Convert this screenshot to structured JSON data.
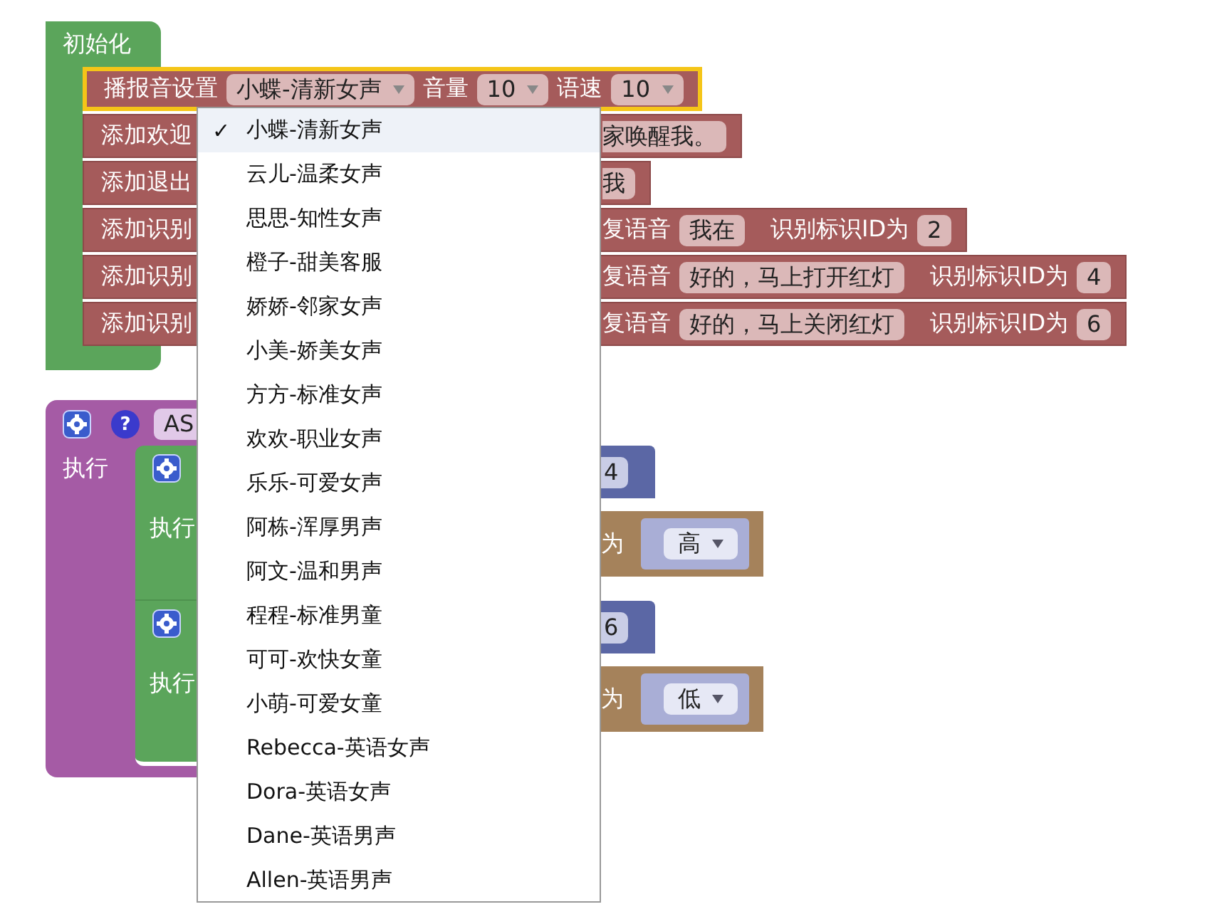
{
  "init_block": {
    "label": "初始化",
    "statements": [
      {
        "kind": "voice",
        "selected": true,
        "label": "播报音设置",
        "voice": "小蝶-清新女声",
        "volume_label": "音量",
        "volume": "10",
        "speed_label": "语速",
        "speed": "10"
      },
      {
        "kind": "text",
        "selected": false,
        "label": "添加欢迎",
        "value": "家唤醒我。"
      },
      {
        "kind": "text",
        "selected": false,
        "label": "添加退出",
        "value": "我"
      },
      {
        "kind": "recognize",
        "selected": false,
        "label": "添加识别",
        "reply_label": "复语音",
        "reply": "我在",
        "id_label": "识别标识ID为",
        "id": "2"
      },
      {
        "kind": "recognize",
        "selected": false,
        "label": "添加识别",
        "reply_label": "复语音",
        "reply": "好的，马上打开红灯",
        "id_label": "识别标识ID为",
        "id": "4"
      },
      {
        "kind": "recognize",
        "selected": false,
        "label": "添加识别",
        "reply_label": "复语音",
        "reply": "好的，马上关闭红灯",
        "id_label": "识别标识ID为",
        "id": "6"
      }
    ]
  },
  "asr_block": {
    "help": "?",
    "field": "AS",
    "do_label": "执行",
    "branches": [
      {
        "do_label": "执行",
        "number": "4",
        "value_label": "为",
        "value": "高"
      },
      {
        "do_label": "执行",
        "number": "6",
        "value_label": "为",
        "value": "低"
      }
    ]
  },
  "dropdown": {
    "check": "✓",
    "options": [
      {
        "label": "小蝶-清新女声",
        "selected": true
      },
      {
        "label": "云儿-温柔女声",
        "selected": false
      },
      {
        "label": "思思-知性女声",
        "selected": false
      },
      {
        "label": "橙子-甜美客服",
        "selected": false
      },
      {
        "label": "娇娇-邻家女声",
        "selected": false
      },
      {
        "label": "小美-娇美女声",
        "selected": false
      },
      {
        "label": "方方-标准女声",
        "selected": false
      },
      {
        "label": "欢欢-职业女声",
        "selected": false
      },
      {
        "label": "乐乐-可爱女声",
        "selected": false
      },
      {
        "label": "阿栋-浑厚男声",
        "selected": false
      },
      {
        "label": "阿文-温和男声",
        "selected": false
      },
      {
        "label": "程程-标准男童",
        "selected": false
      },
      {
        "label": "可可-欢快女童",
        "selected": false
      },
      {
        "label": "小萌-可爱女童",
        "selected": false
      },
      {
        "label": "Rebecca-英语女声",
        "selected": false
      },
      {
        "label": "Dora-英语女声",
        "selected": false
      },
      {
        "label": "Dane-英语男声",
        "selected": false
      },
      {
        "label": "Allen-英语男声",
        "selected": false
      }
    ]
  }
}
